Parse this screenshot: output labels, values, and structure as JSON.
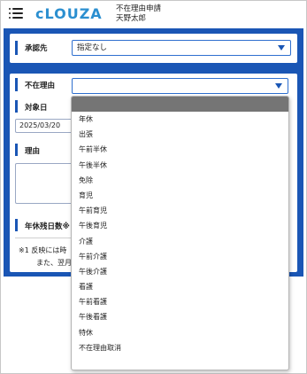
{
  "header": {
    "logo_text": "cLOUZA",
    "page_title": "不在理由申請",
    "user_name": "天野太郎"
  },
  "approver": {
    "label": "承認先",
    "selected": "指定なし"
  },
  "absence_reason": {
    "label": "不在理由",
    "selected": ""
  },
  "target_date": {
    "label": "対象日",
    "value": "2025/03/20"
  },
  "reason": {
    "label": "理由"
  },
  "annual_leave": {
    "label": "年休残日数※"
  },
  "notes": {
    "line1": "※1 反映には時",
    "line2": "また、翌月"
  },
  "dropdown": {
    "options": [
      "年休",
      "出張",
      "午前半休",
      "午後半休",
      "免除",
      "育児",
      "午前育児",
      "午後育児",
      "介護",
      "午前介護",
      "午後介護",
      "看護",
      "午前看護",
      "午後看護",
      "特休",
      "不在理由取消"
    ]
  },
  "colors": {
    "primary_blue": "#1a56b5",
    "logo_blue": "#2b8fd0",
    "logo_accent": "#e2532a",
    "dropdown_blank": "#757575"
  }
}
